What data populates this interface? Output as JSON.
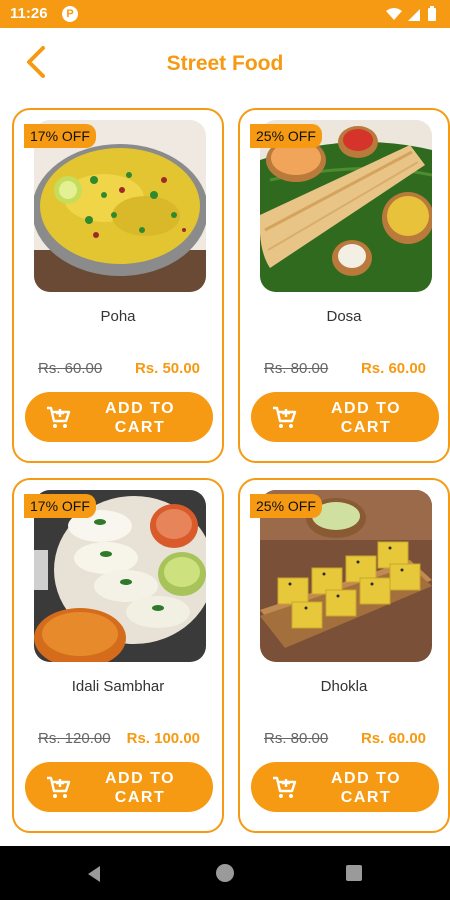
{
  "status": {
    "time": "11:26",
    "app_icon": "P"
  },
  "header": {
    "title": "Street Food",
    "back_icon": "chevron-left-icon"
  },
  "colors": {
    "accent": "#F59A12",
    "bar_text": "#ffffff"
  },
  "products": [
    {
      "name": "Poha",
      "discount": "17% OFF",
      "old_price": "Rs. 60.00",
      "new_price": "Rs. 50.00",
      "button_line1": "ADD TO",
      "button_line2": "CART"
    },
    {
      "name": "Dosa",
      "discount": "25% OFF",
      "old_price": "Rs. 80.00",
      "new_price": "Rs. 60.00",
      "button_line1": "ADD TO",
      "button_line2": "CART"
    },
    {
      "name": "Idali Sambhar",
      "discount": "17% OFF",
      "old_price": "Rs. 120.00",
      "new_price": "Rs. 100.00",
      "button_line1": "ADD TO",
      "button_line2": "CART"
    },
    {
      "name": "Dhokla",
      "discount": "25% OFF",
      "old_price": "Rs. 80.00",
      "new_price": "Rs. 60.00",
      "button_line1": "ADD TO",
      "button_line2": "CART"
    }
  ]
}
